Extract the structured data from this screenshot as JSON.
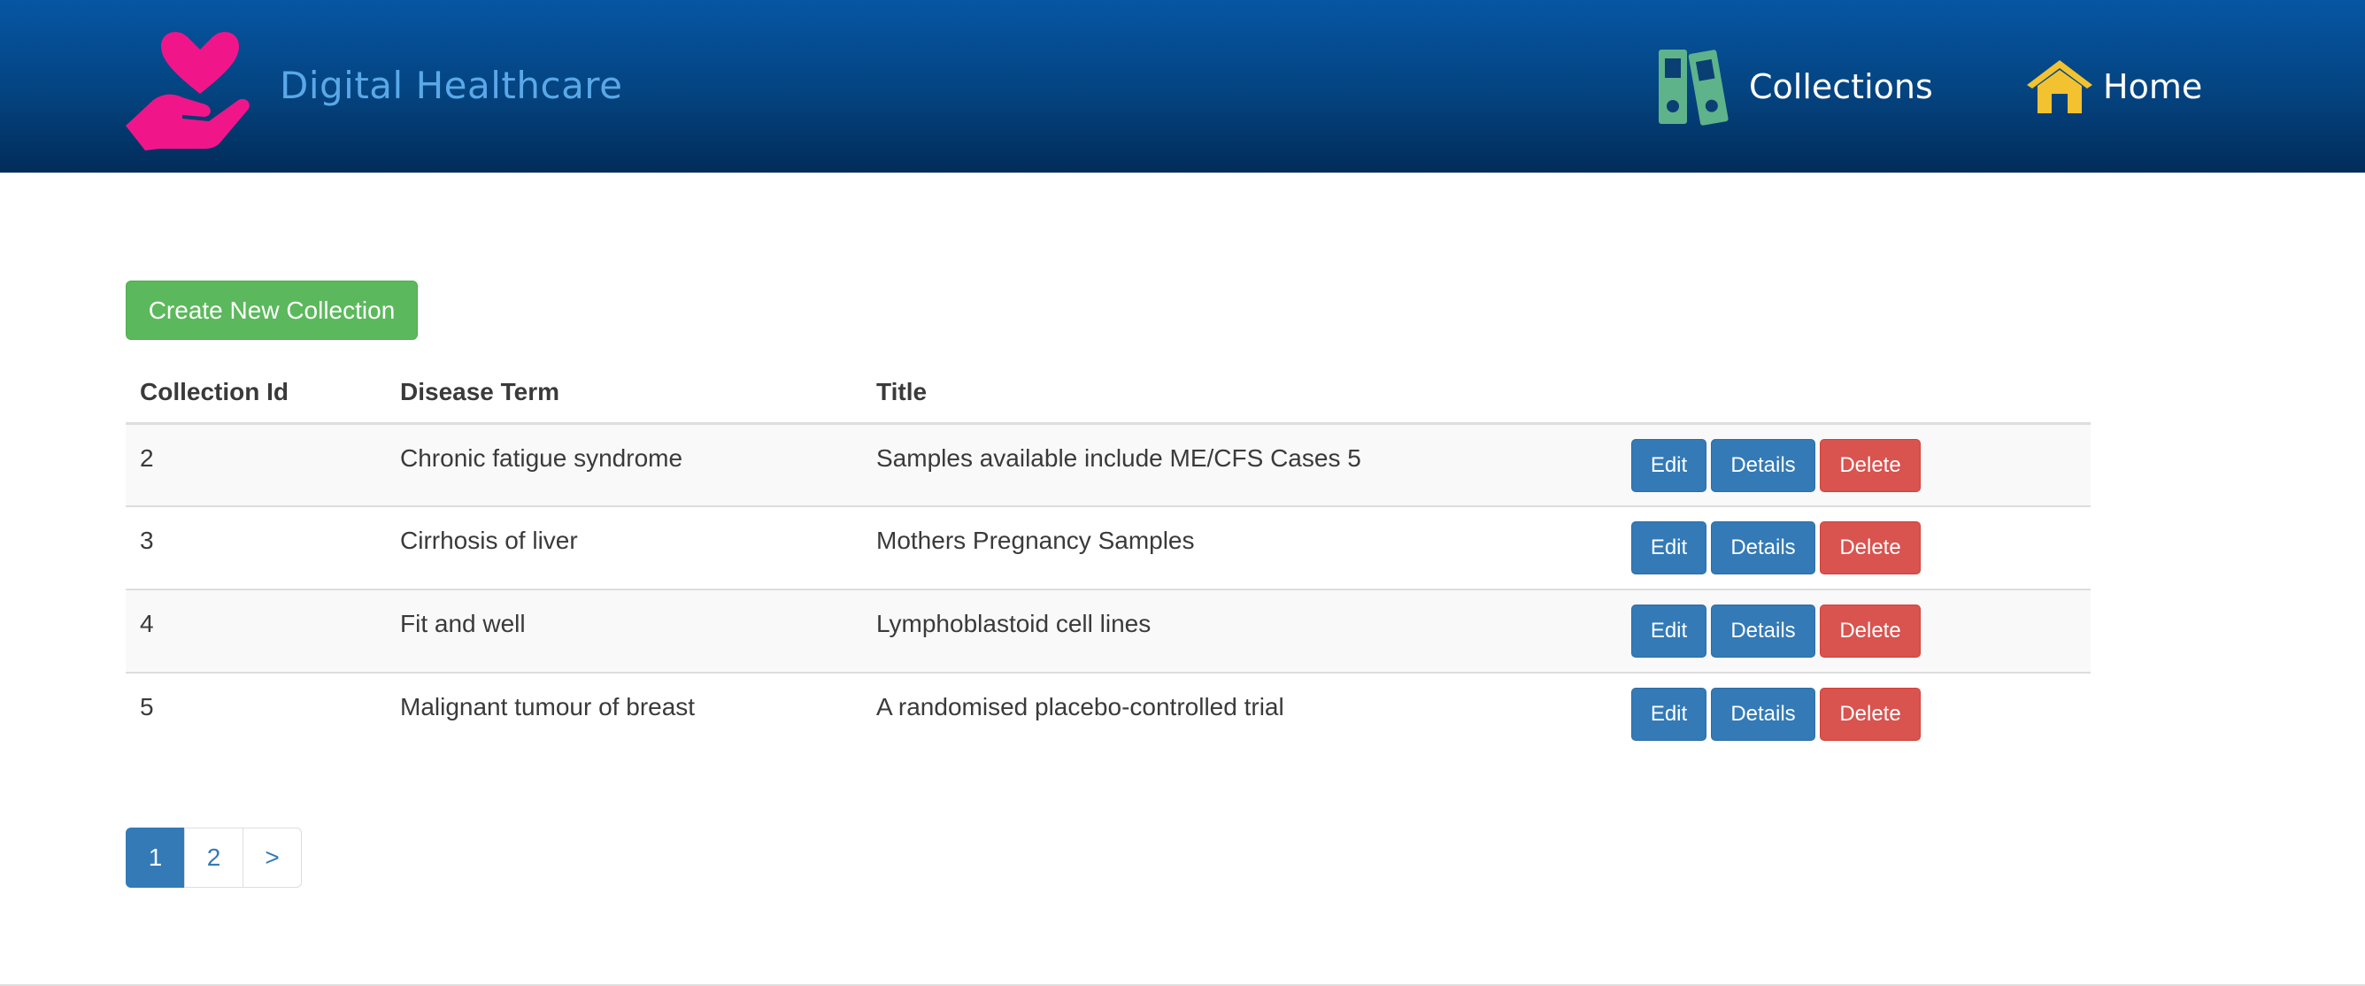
{
  "header": {
    "brand_text": "Digital Healthcare",
    "brand_logo_icon": "heart-in-hand-icon",
    "nav": [
      {
        "label": "Collections",
        "icon": "binders-icon"
      },
      {
        "label": "Home",
        "icon": "house-icon"
      }
    ]
  },
  "main": {
    "create_button_label": "Create New Collection",
    "table": {
      "columns": [
        "Collection Id",
        "Disease Term",
        "Title"
      ],
      "rows": [
        {
          "id": "2",
          "disease_term": "Chronic fatigue syndrome",
          "title": "Samples available include ME/CFS Cases 5"
        },
        {
          "id": "3",
          "disease_term": "Cirrhosis of liver",
          "title": "Mothers Pregnancy Samples"
        },
        {
          "id": "4",
          "disease_term": "Fit and well",
          "title": "Lymphoblastoid cell lines"
        },
        {
          "id": "5",
          "disease_term": "Malignant tumour of breast",
          "title": "A randomised placebo-controlled trial"
        }
      ],
      "actions": {
        "edit": "Edit",
        "details": "Details",
        "delete": "Delete"
      }
    },
    "pagination": {
      "pages": [
        "1",
        "2"
      ],
      "next_label": ">",
      "current_page": "1"
    }
  },
  "colors": {
    "header_top": "#0656a4",
    "header_bottom": "#022c5a",
    "brand_text": "#5aa8e8",
    "logo": "#f0168a",
    "collections_icon": "#5fb38a",
    "home_icon": "#f2c230",
    "success": "#5cb85c",
    "primary": "#337ab7",
    "danger": "#d9534f"
  }
}
